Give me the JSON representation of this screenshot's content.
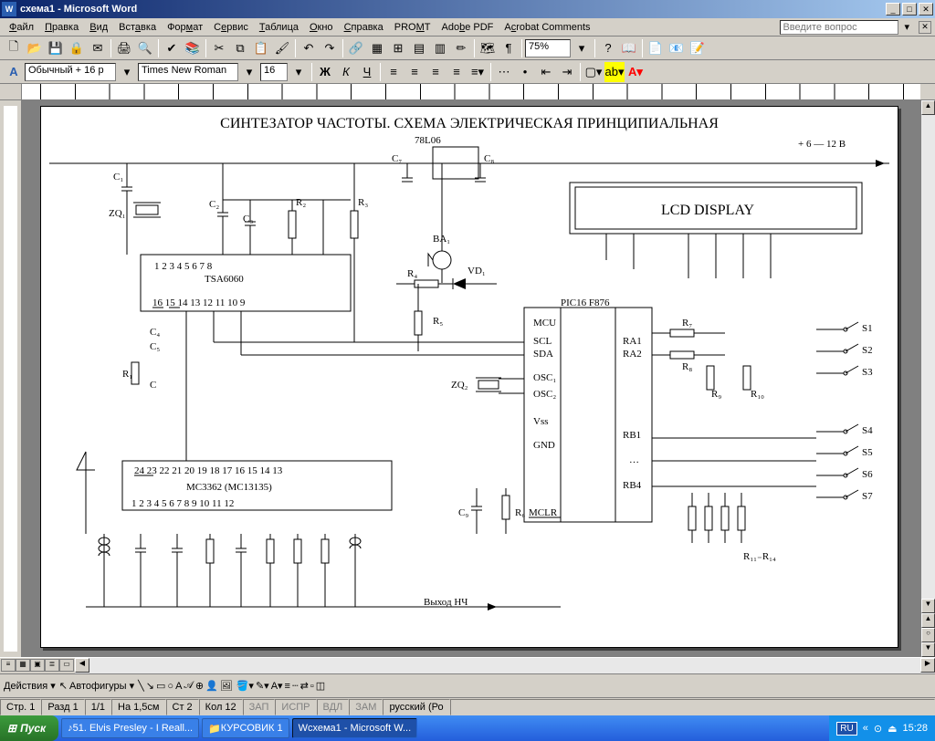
{
  "window": {
    "title": "схема1 - Microsoft Word"
  },
  "menu": {
    "items": [
      "Файл",
      "Правка",
      "Вид",
      "Вставка",
      "Формат",
      "Сервис",
      "Таблица",
      "Окно",
      "Справка",
      "PROMT",
      "Adobe PDF",
      "Acrobat Comments"
    ],
    "question_placeholder": "Введите вопрос"
  },
  "toolbar1": {
    "zoom": "75%"
  },
  "toolbar2": {
    "style": "Обычный + 16 р",
    "font": "Times New Roman",
    "size": "16"
  },
  "drawbar": {
    "actions": "Действия",
    "autoshapes": "Автофигуры"
  },
  "status": {
    "page": "Стр. 1",
    "section": "Разд 1",
    "pages": "1/1",
    "at": "На 1,5см",
    "line": "Ст 2",
    "col": "Кол 12",
    "zap": "ЗАП",
    "ispr": "ИСПР",
    "vdl": "ВДЛ",
    "zam": "ЗАМ",
    "lang": "русский (Ро"
  },
  "taskbar": {
    "start": "Пуск",
    "items": [
      {
        "label": "51. Elvis Presley - I Reall...",
        "active": false
      },
      {
        "label": "КУРСОВИК 1",
        "active": false
      },
      {
        "label": "схема1 - Microsoft W...",
        "active": true
      }
    ],
    "lang": "RU",
    "time": "15:28"
  },
  "schematic": {
    "title": "СИНТЕЗАТОР ЧАСТОТЫ. СХЕМА ЭЛЕКТРИЧЕСКАЯ ПРИНЦИПИАЛЬНАЯ",
    "reg": "78L06",
    "power": "+ 6 — 12 В",
    "lcd": "LCD DISPLAY",
    "ic1": "TSA6060",
    "ic1_pins_top": "1  2  3  4  5  6  7  8",
    "ic1_pins_bot": "16  15  14 13  12 11 10  9",
    "ic2": "MC3362  (MC13135)",
    "ic2_pins_top": "24  23  22  21 20 19 18 17 16  15  14  13",
    "ic2_pins_bot": "1   2   3   4   5   6   7    8   9  10  11  12",
    "mcu": "PIC16 F876",
    "mcu_pins": [
      "MCU",
      "SCL",
      "SDA",
      "OSC₁",
      "OSC₂",
      "Vss",
      "GND",
      "MCLR",
      "RA1",
      "RA2",
      "RB1",
      "…",
      "RB4"
    ],
    "labels": {
      "C1": "C₁",
      "C2": "C₂",
      "C3": "C₃",
      "C4": "C₄",
      "C5": "C₅",
      "C6": "C",
      "C7": "C₇",
      "C8": "C₈",
      "C9": "C₉",
      "R1": "R₁",
      "R2": "R₂",
      "R3": "R₃",
      "R4": "R₄",
      "R5": "R₅",
      "R6": "R₆",
      "R7": "R₇",
      "R8": "R₈",
      "R9": "R₉",
      "R10": "R₁₀",
      "R11_14": "R₁₁₋R₁₄",
      "ZQ1": "ZQ₁",
      "ZQ2": "ZQ₂",
      "BA1": "BA₁",
      "VD1": "VD₁",
      "S1": "S1",
      "S2": "S2",
      "S3": "S3",
      "S4": "S4",
      "S5": "S5",
      "S6": "S6",
      "S7": "S7",
      "out": "Выход НЧ"
    }
  }
}
